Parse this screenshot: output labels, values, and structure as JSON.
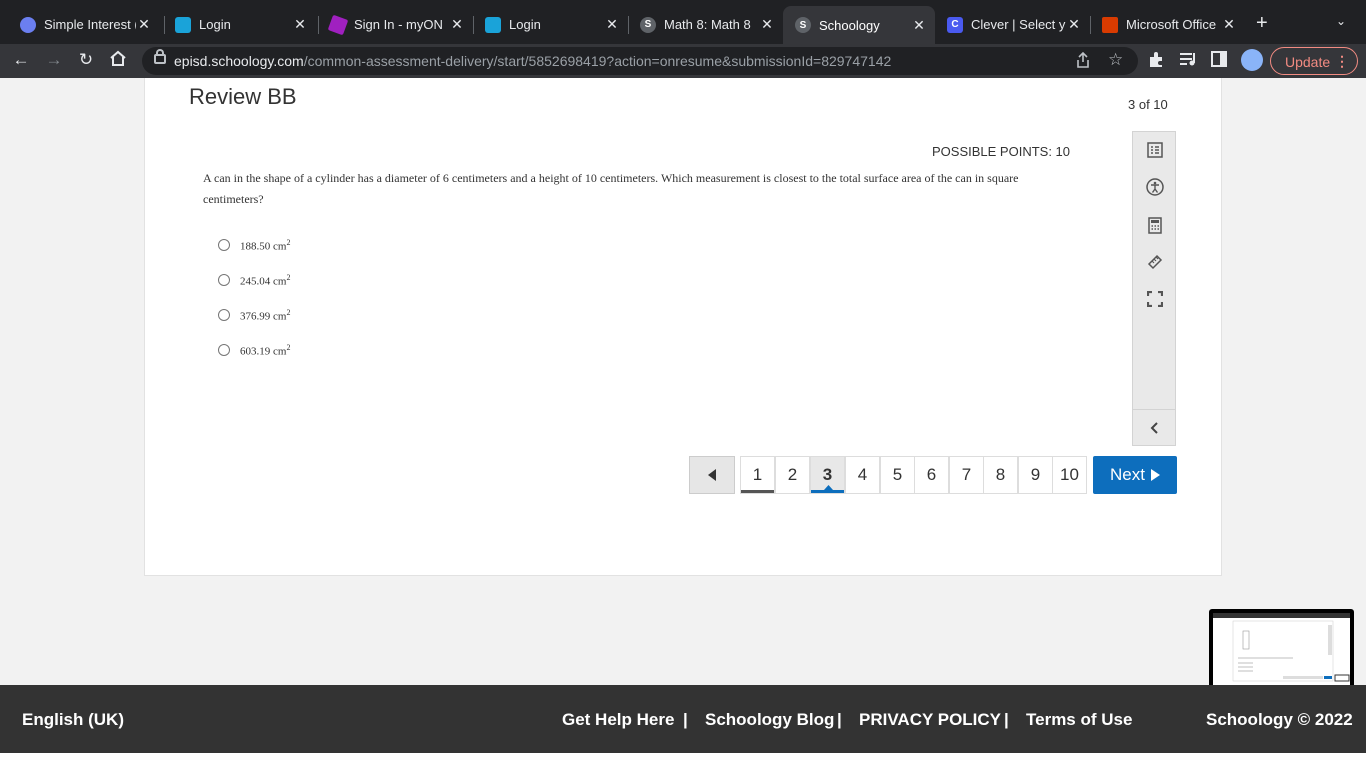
{
  "browser": {
    "tabs": [
      {
        "title": "Simple Interest (",
        "icon": "globe-icon",
        "color": "#6b7ff0"
      },
      {
        "title": "Login",
        "icon": "cloud-icon",
        "color": "#1aa3d9"
      },
      {
        "title": "Sign In - myON",
        "icon": "myon-icon",
        "color": "#a020c0"
      },
      {
        "title": "Login",
        "icon": "cloud-icon",
        "color": "#1aa3d9"
      },
      {
        "title": "Math 8: Math 8",
        "icon": "schoology-icon",
        "color": "#3a4048"
      },
      {
        "title": "Schoology",
        "icon": "schoology-icon",
        "color": "#3a4048"
      },
      {
        "title": "Clever | Select y",
        "icon": "clever-icon",
        "color": "#4a5af0"
      },
      {
        "title": "Microsoft Office",
        "icon": "office-icon",
        "color": "#d83b01"
      }
    ],
    "tab_letters": [
      "",
      "",
      "",
      "",
      "S",
      "S",
      "C",
      ""
    ],
    "close_glyph": "✕",
    "new_tab": "+",
    "tab_menu": "⌄",
    "url_domain": "episd.schoology.com",
    "url_path": "/common-assessment-delivery/start/5852698419?action=onresume&submissionId=829747142",
    "update_label": "Update"
  },
  "assessment": {
    "title": "Review BB",
    "progress": "3 of 10",
    "points": "POSSIBLE POINTS: 10",
    "question": "A can in the shape of a cylinder has a diameter of 6 centimeters and a height of 10 centimeters. Which measurement is closest to the total surface area of the can in square centimeters?",
    "choices": [
      {
        "value": "188.50 cm",
        "sup": "2"
      },
      {
        "value": "245.04 cm",
        "sup": "2"
      },
      {
        "value": "376.99 cm",
        "sup": "2"
      },
      {
        "value": "603.19 cm",
        "sup": "2"
      }
    ],
    "pages": [
      "1",
      "2",
      "3",
      "4",
      "5",
      "6",
      "7",
      "8",
      "9",
      "10"
    ],
    "current_page": "3",
    "next_label": "Next",
    "accent": "#0d6ebd"
  },
  "footer": {
    "language": "English (UK)",
    "help": "Get Help Here",
    "blog": "Schoology Blog",
    "privacy": "PRIVACY POLICY",
    "terms": "Terms of Use",
    "copyright": "Schoology © 2022",
    "divider": "|"
  }
}
